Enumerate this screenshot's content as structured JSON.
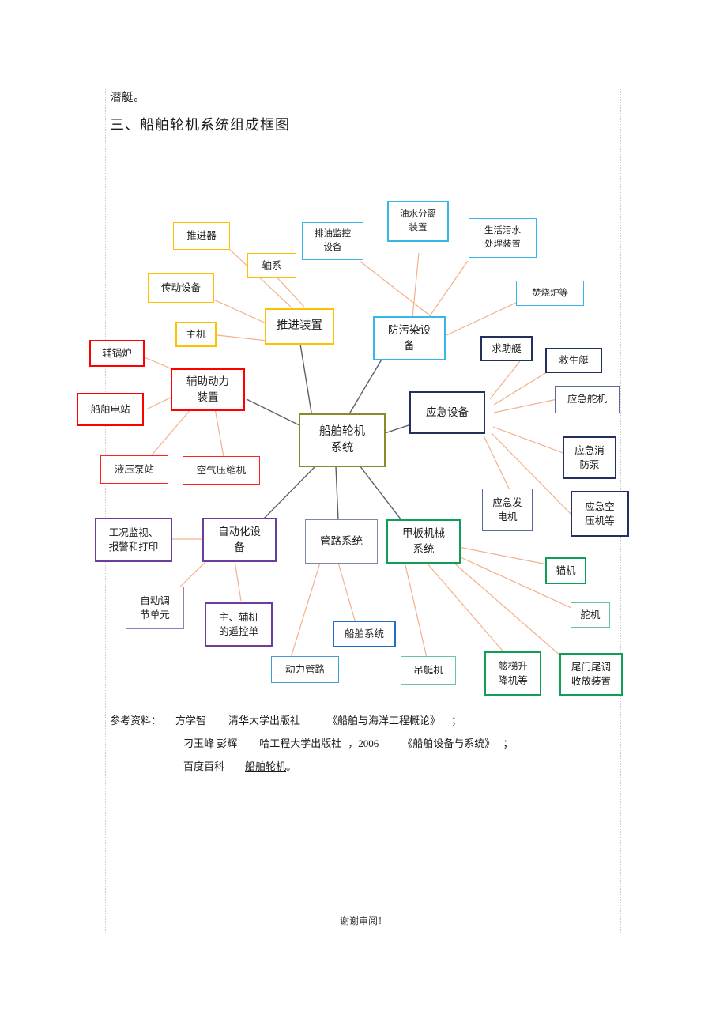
{
  "document": {
    "body_text": "潜艇。",
    "heading": "三、船舶轮机系统组成框图",
    "footer": "谢谢审阅！"
  },
  "diagram": {
    "center": {
      "line1": "船舶轮机",
      "line2": "系统",
      "color": "#8a8a2b"
    },
    "branches": {
      "propulsion": {
        "line1": "推进装置",
        "line2": "",
        "color": "#ffc000"
      },
      "antipollution": {
        "line1": "防污染设",
        "line2": "备",
        "color": "#35b7e8"
      },
      "auxpower": {
        "line1": "辅助动力",
        "line2": "装置",
        "color": "#ff0000"
      },
      "emergency": {
        "line1": "应急设备",
        "line2": "",
        "color": "#22305e"
      },
      "automation": {
        "line1": "自动化设",
        "line2": "备",
        "color": "#6d3d9e"
      },
      "piping": {
        "line1": "管路系统",
        "line2": "",
        "color": "#7b88a8"
      },
      "deck": {
        "line1": "甲板机械",
        "line2": "系统",
        "color": "#0f9e55"
      }
    },
    "leaves": {
      "propeller": {
        "line1": "推进器",
        "line2": ""
      },
      "shafting": {
        "line1": "轴系",
        "line2": ""
      },
      "transmission": {
        "line1": "传动设备",
        "line2": ""
      },
      "main_engine": {
        "line1": "主机",
        "line2": ""
      },
      "oil_monitor": {
        "line1": "排油监控",
        "line2": "设备"
      },
      "oil_water_sep": {
        "line1": "油水分离",
        "line2": "装置"
      },
      "sewage": {
        "line1": "生活污水",
        "line2": "处理装置"
      },
      "incinerator": {
        "line1": "焚烧炉等",
        "line2": ""
      },
      "aux_boiler": {
        "line1": "辅锅炉",
        "line2": ""
      },
      "power_station": {
        "line1": "船舶电站",
        "line2": ""
      },
      "hydraulic": {
        "line1": "液压泵站",
        "line2": ""
      },
      "air_compressor": {
        "line1": "空气压缩机",
        "line2": ""
      },
      "rescue_boat": {
        "line1": "求助艇",
        "line2": ""
      },
      "life_boat": {
        "line1": "救生艇",
        "line2": ""
      },
      "emg_steering": {
        "line1": "应急舵机",
        "line2": ""
      },
      "emg_fire_pump": {
        "line1": "应急消",
        "line2": "防泵"
      },
      "emg_generator": {
        "line1": "应急发",
        "line2": "电机"
      },
      "emg_air_comp": {
        "line1": "应急空",
        "line2": "压机等"
      },
      "monitoring": {
        "line1": "工况监视、",
        "line2": "报警和打印"
      },
      "auto_reg_unit": {
        "line1": "自动调",
        "line2": "节单元"
      },
      "remote_ctrl": {
        "line1": "主、辅机",
        "line2": "的遥控单"
      },
      "ship_system": {
        "line1": "船舶系统",
        "line2": ""
      },
      "power_piping": {
        "line1": "动力管路",
        "line2": ""
      },
      "boat_davit": {
        "line1": "吊艇机",
        "line2": ""
      },
      "windlass": {
        "line1": "锚机",
        "line2": ""
      },
      "steering_gear": {
        "line1": "舵机",
        "line2": ""
      },
      "gangway_lift": {
        "line1": "舷梯升",
        "line2": "降机等"
      },
      "stern_door": {
        "line1": "尾门尾调",
        "line2": "收放装置"
      }
    }
  },
  "references": {
    "label": "参考资料：",
    "rows": [
      {
        "author": "方学智",
        "publisher": "清华大学出版社",
        "title": "《船舶与海洋工程概论》",
        "year": "",
        "end": "；"
      },
      {
        "author": "刁玉峰    彭辉",
        "publisher": "哈工程大学出版社",
        "title": "《船舶设备与系统》",
        "year": "，2006",
        "end": "；"
      },
      {
        "author": "百度百科",
        "publisher": "",
        "title": "",
        "year": "",
        "end": "。",
        "link": "船舶轮机"
      }
    ]
  }
}
